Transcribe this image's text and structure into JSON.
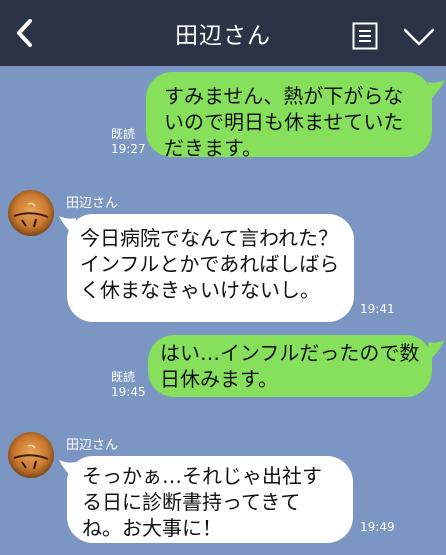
{
  "header": {
    "title": "田辺さん"
  },
  "messages": [
    {
      "side": "me",
      "text": "すみません、熱が下がらないので明日も休ませていただきます。",
      "read": "既読",
      "time": "19:27"
    },
    {
      "side": "other",
      "sender": "田辺さん",
      "text": "今日病院でなんて言われた？インフルとかであればしばらく休まなきゃいけないし。",
      "time": "19:41"
    },
    {
      "side": "me",
      "text": "はい…インフルだったので数日休みます。",
      "read": "既読",
      "time": "19:45"
    },
    {
      "side": "other",
      "sender": "田辺さん",
      "text": "そっかぁ…それじゃ出社する日に診断書持ってきてね。お大事に！",
      "time": "19:49"
    }
  ],
  "colors": {
    "background": "#7b96c2",
    "header": "#2b3446",
    "my_bubble": "#86e05b",
    "other_bubble": "#ffffff"
  }
}
